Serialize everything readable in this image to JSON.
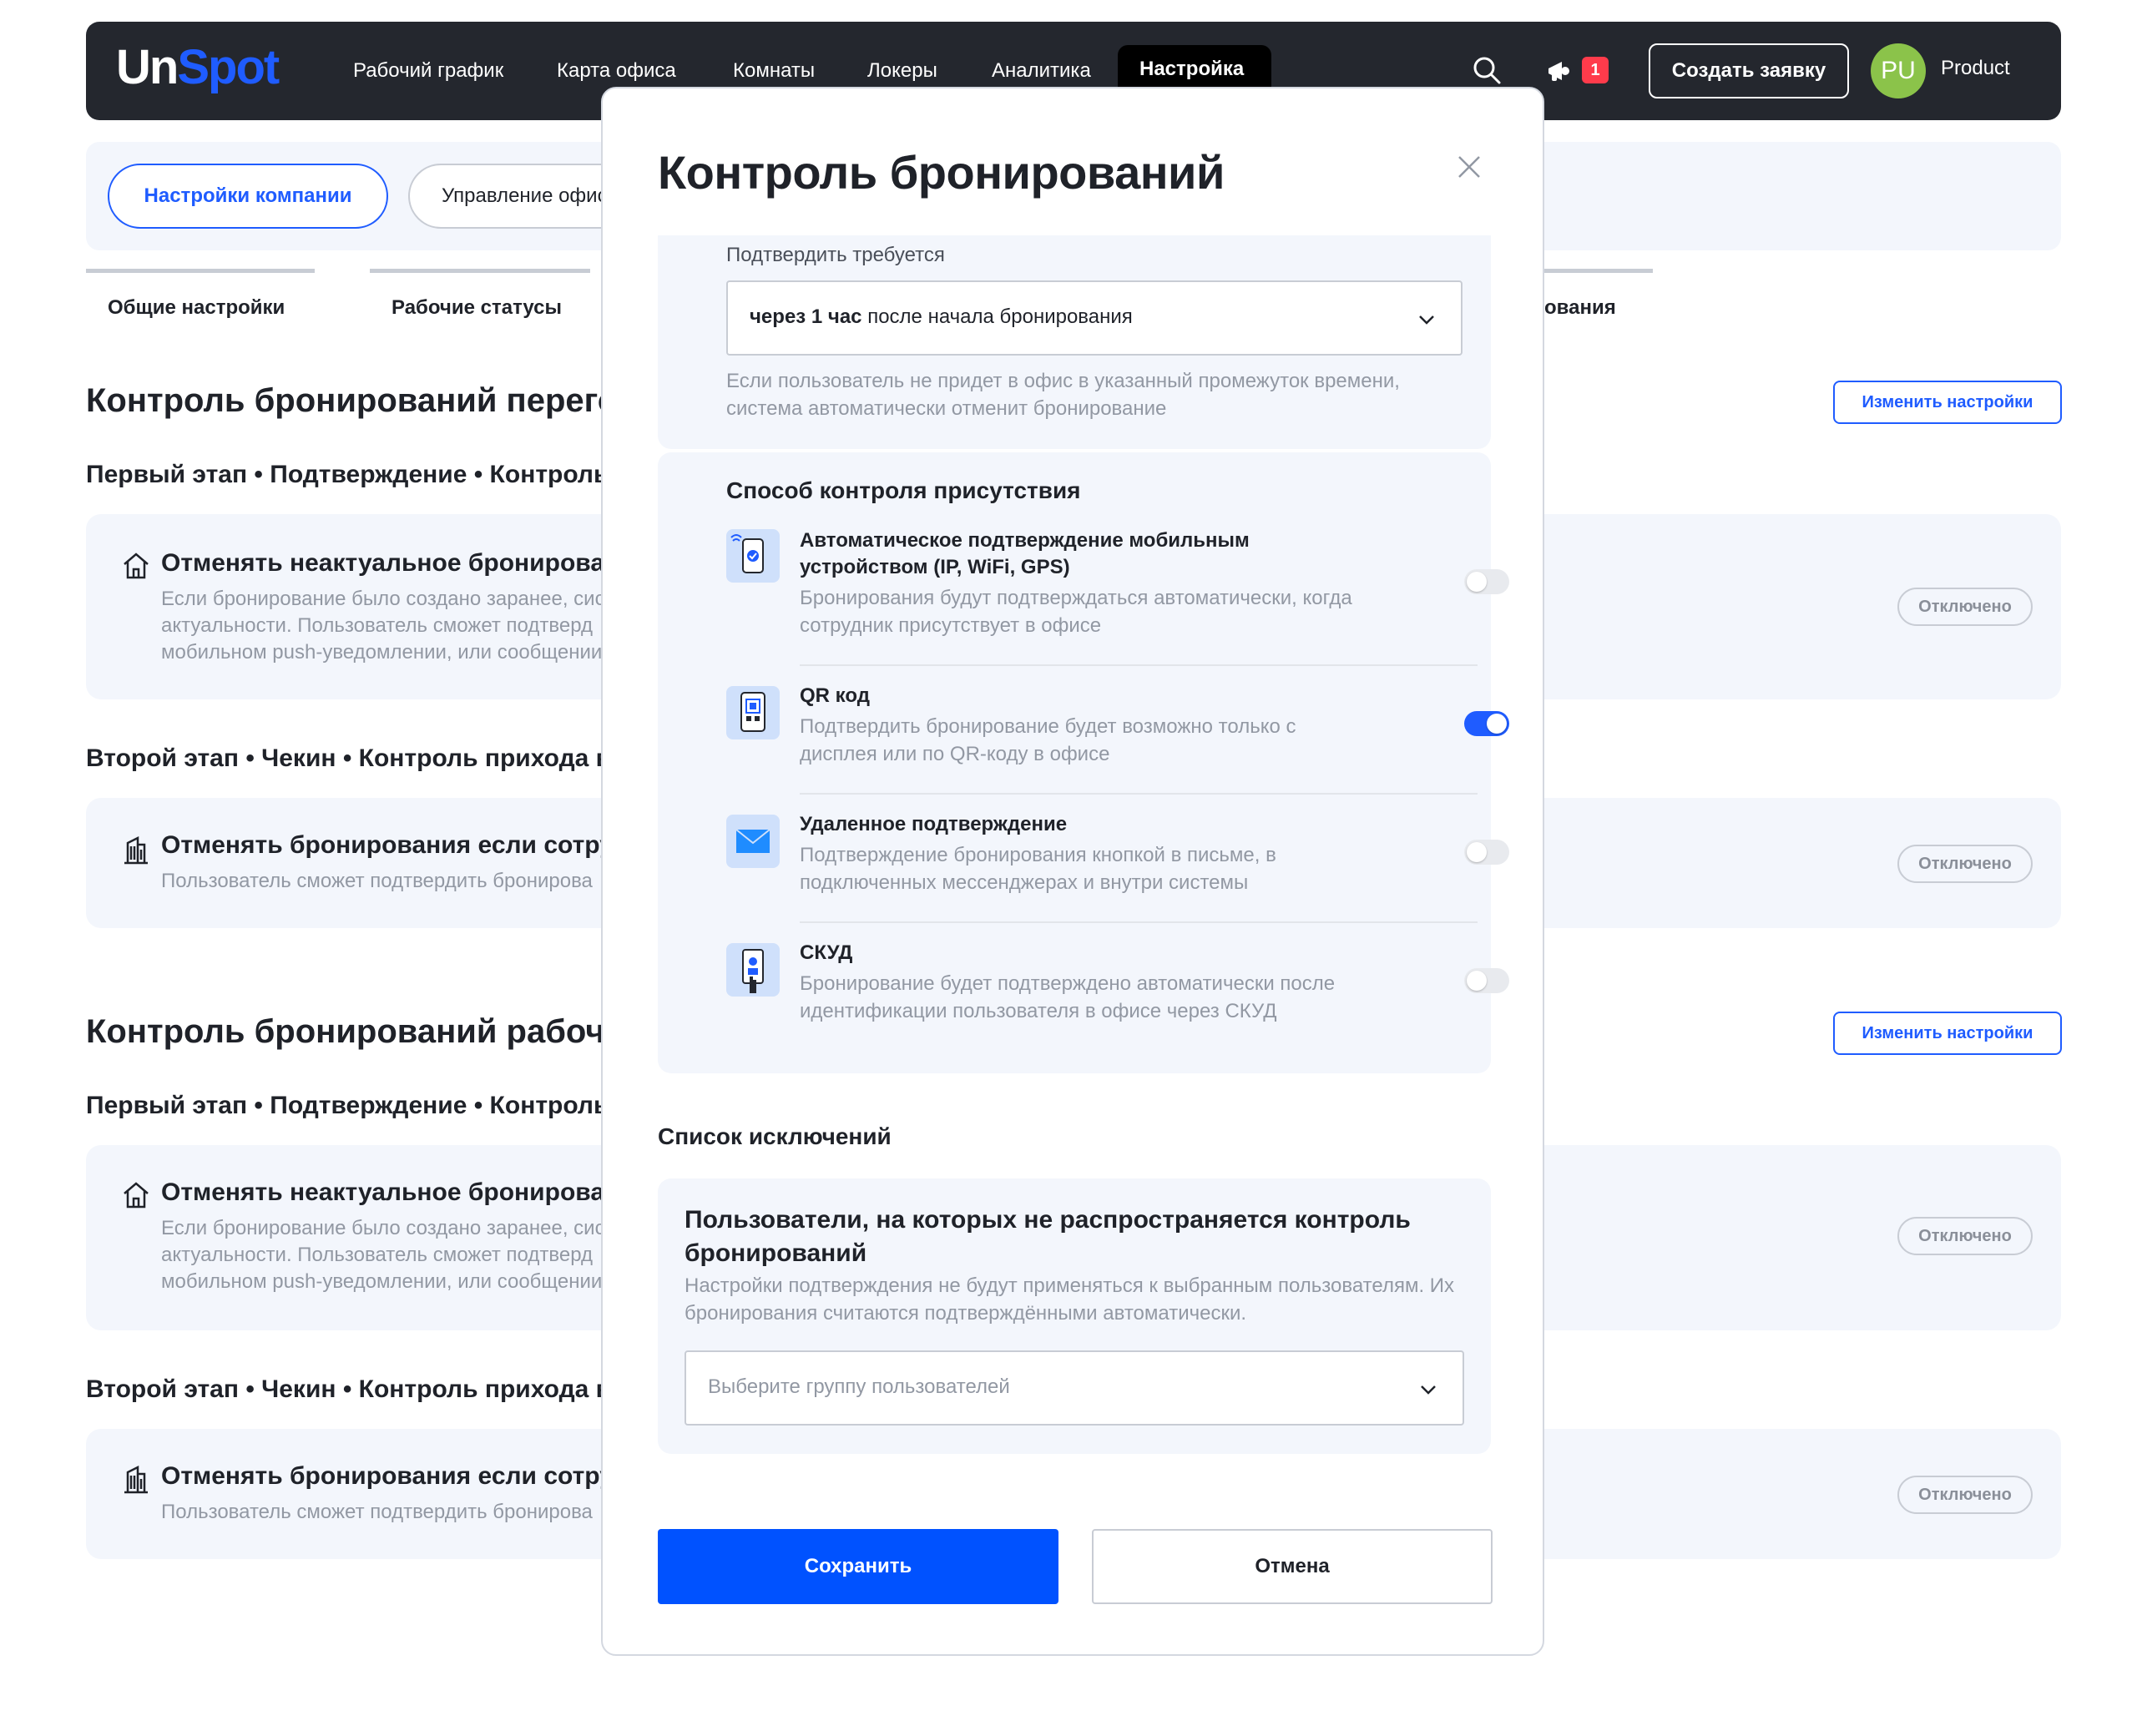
{
  "header": {
    "logo_un": "Un",
    "logo_spot": "Spot",
    "nav": [
      "Рабочий график",
      "Карта офиса",
      "Комнаты",
      "Локеры",
      "Аналитика"
    ],
    "nav_active": "Настройка",
    "notifications_count": "1",
    "create_label": "Создать заявку",
    "avatar_initials": "PU",
    "user_name": "Product"
  },
  "subbar": {
    "company_settings": "Настройки компании",
    "office_management": "Управление офис"
  },
  "tabs": {
    "general": "Общие настройки",
    "statuses": "Рабочие статусы",
    "bookings_tail": "ования"
  },
  "page": {
    "section1_title": "Контроль бронирований перего",
    "section2_title": "Контроль бронирований рабоч",
    "edit_label": "Изменить настройки",
    "stage1": "Первый этап • Подтверждение • Контроль",
    "stage2": "Второй этап • Чекин • Контроль прихода в",
    "card1_title": "Отменять неактуальное бронирова",
    "card1_desc": [
      "Если бронирование было создано заранее, сис",
      "актуальности. Пользователь сможет подтверд",
      "мобильном push-уведомлении, или сообщении"
    ],
    "card2_title": "Отменять бронирования если сотру",
    "card2_desc": "Пользователь сможет подтвердить бронирова",
    "off_label": "Отключено"
  },
  "modal": {
    "title": "Контроль бронирований",
    "confirm_label": "Подтвердить требуется",
    "confirm_value_bold": "через 1 час",
    "confirm_value_rest": " после начала бронирования",
    "confirm_hint": [
      "Если пользователь не придет в офис в указанный промежуток времени,",
      "система автоматически отменит бронирование"
    ],
    "method_title": "Способ контроля присутствия",
    "options": [
      {
        "title": [
          "Автоматическое подтверждение мобильным",
          "устройством (IP, WiFi, GPS)"
        ],
        "desc": [
          "Бронирования будут подтверждаться автоматически, когда",
          "сотрудник присутствует в офисе"
        ],
        "enabled": false
      },
      {
        "title": [
          "QR код"
        ],
        "desc": [
          "Подтвердить бронирование будет возможно только с",
          "дисплея или по QR-коду в офисе"
        ],
        "enabled": true
      },
      {
        "title": [
          "Удаленное подтверждение"
        ],
        "desc": [
          "Подтверждение бронирования кнопкой в письме, в",
          "подключенных мессенджерах и внутри системы"
        ],
        "enabled": false
      },
      {
        "title": [
          "СКУД"
        ],
        "desc": [
          "Бронирование будет подтверждено автоматически после",
          "идентификации пользователя в офисе через СКУД"
        ],
        "enabled": false
      }
    ],
    "exceptions_title": "Список исключений",
    "exceptions_card_title": [
      "Пользователи, на которых не распространяется контроль",
      "бронирований"
    ],
    "exceptions_desc": [
      "Настройки подтверждения не будут применяться к выбранным пользователям. Их",
      "бронирования считаются подтверждёнными автоматически."
    ],
    "group_placeholder": "Выберите группу пользователей",
    "save_label": "Сохранить",
    "cancel_label": "Отмена"
  },
  "colors": {
    "accent": "#1f5cff",
    "header_bg": "#24272e",
    "badge": "#ff3b4b",
    "avatar": "#8bc34a"
  }
}
